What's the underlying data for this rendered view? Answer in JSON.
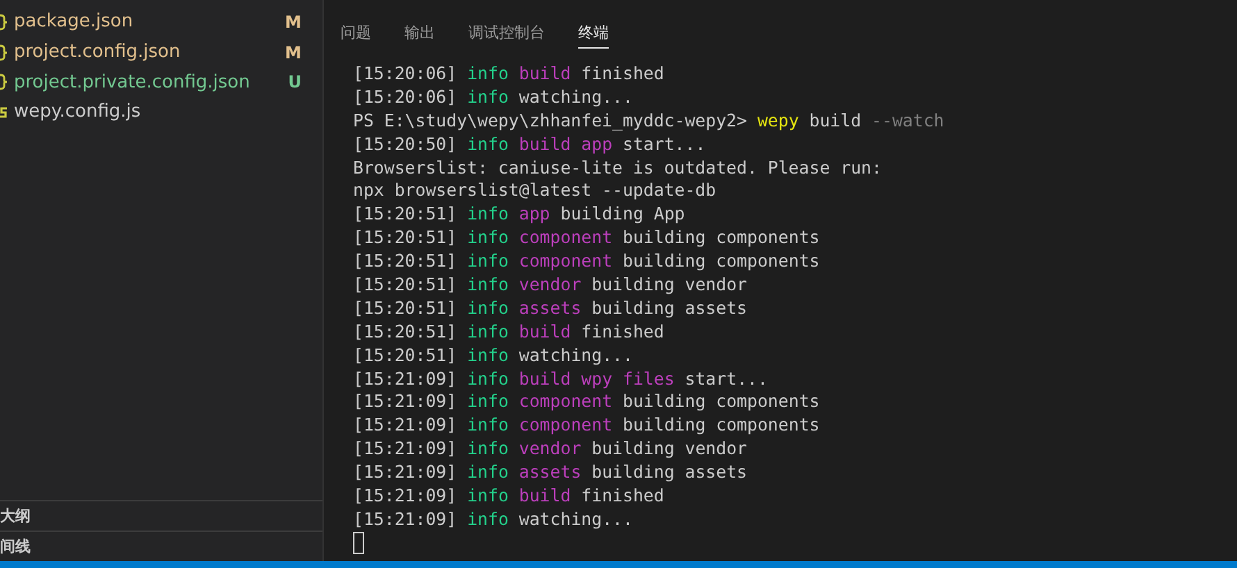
{
  "sidebar": {
    "files": [
      {
        "name": "package.json",
        "kind": "modified",
        "badge": "M"
      },
      {
        "name": "project.config.json",
        "kind": "modified",
        "badge": "M"
      },
      {
        "name": "project.private.config.json",
        "kind": "untracked",
        "badge": "U"
      },
      {
        "name": "wepy.config.js",
        "kind": "normal"
      }
    ],
    "sections": [
      {
        "label": "大纲"
      },
      {
        "label": "间线"
      }
    ]
  },
  "panel": {
    "tabs": [
      {
        "label": "问题",
        "selected": false
      },
      {
        "label": "输出",
        "selected": false
      },
      {
        "label": "调试控制台",
        "selected": false
      },
      {
        "label": "终端",
        "selected": true
      }
    ],
    "terminal": {
      "lines": [
        [
          {
            "text": "[15:20:06]",
            "kind": "plain"
          },
          {
            "text": "info",
            "kind": "info"
          },
          {
            "text": "build",
            "kind": "tag"
          },
          {
            "text": "finished",
            "kind": "plain"
          }
        ],
        [
          {
            "text": "[15:20:06]",
            "kind": "plain"
          },
          {
            "text": "info",
            "kind": "info"
          },
          {
            "text": "watching...",
            "kind": "plain"
          }
        ],
        [
          {
            "text": "PS E:\\study\\wepy\\zhhanfei_myddc-wepy2>",
            "kind": "plain"
          },
          {
            "text": "wepy",
            "kind": "cmd"
          },
          {
            "text": "build",
            "kind": "plain"
          },
          {
            "text": "--watch",
            "kind": "flag"
          }
        ],
        [
          {
            "text": "[15:20:50]",
            "kind": "plain"
          },
          {
            "text": "info",
            "kind": "info"
          },
          {
            "text": "build app",
            "kind": "tag"
          },
          {
            "text": "start...",
            "kind": "plain"
          }
        ],
        [
          {
            "text": "Browserslist: caniuse-lite is outdated. Please run:",
            "kind": "plain"
          }
        ],
        [
          {
            "text": "npx browserslist@latest --update-db",
            "kind": "plain"
          }
        ],
        [
          {
            "text": "[15:20:51]",
            "kind": "plain"
          },
          {
            "text": "info",
            "kind": "info"
          },
          {
            "text": "app",
            "kind": "tag"
          },
          {
            "text": "building App",
            "kind": "plain"
          }
        ],
        [
          {
            "text": "[15:20:51]",
            "kind": "plain"
          },
          {
            "text": "info",
            "kind": "info"
          },
          {
            "text": "component",
            "kind": "tag"
          },
          {
            "text": "building components",
            "kind": "plain"
          }
        ],
        [
          {
            "text": "[15:20:51]",
            "kind": "plain"
          },
          {
            "text": "info",
            "kind": "info"
          },
          {
            "text": "component",
            "kind": "tag"
          },
          {
            "text": "building components",
            "kind": "plain"
          }
        ],
        [
          {
            "text": "[15:20:51]",
            "kind": "plain"
          },
          {
            "text": "info",
            "kind": "info"
          },
          {
            "text": "vendor",
            "kind": "tag"
          },
          {
            "text": "building vendor",
            "kind": "plain"
          }
        ],
        [
          {
            "text": "[15:20:51]",
            "kind": "plain"
          },
          {
            "text": "info",
            "kind": "info"
          },
          {
            "text": "assets",
            "kind": "tag"
          },
          {
            "text": "building assets",
            "kind": "plain"
          }
        ],
        [
          {
            "text": "[15:20:51]",
            "kind": "plain"
          },
          {
            "text": "info",
            "kind": "info"
          },
          {
            "text": "build",
            "kind": "tag"
          },
          {
            "text": "finished",
            "kind": "plain"
          }
        ],
        [
          {
            "text": "[15:20:51]",
            "kind": "plain"
          },
          {
            "text": "info",
            "kind": "info"
          },
          {
            "text": "watching...",
            "kind": "plain"
          }
        ],
        [
          {
            "text": "[15:21:09]",
            "kind": "plain"
          },
          {
            "text": "info",
            "kind": "info"
          },
          {
            "text": "build wpy files",
            "kind": "tag"
          },
          {
            "text": "start...",
            "kind": "plain"
          }
        ],
        [
          {
            "text": "[15:21:09]",
            "kind": "plain"
          },
          {
            "text": "info",
            "kind": "info"
          },
          {
            "text": "component",
            "kind": "tag"
          },
          {
            "text": "building components",
            "kind": "plain"
          }
        ],
        [
          {
            "text": "[15:21:09]",
            "kind": "plain"
          },
          {
            "text": "info",
            "kind": "info"
          },
          {
            "text": "component",
            "kind": "tag"
          },
          {
            "text": "building components",
            "kind": "plain"
          }
        ],
        [
          {
            "text": "[15:21:09]",
            "kind": "plain"
          },
          {
            "text": "info",
            "kind": "info"
          },
          {
            "text": "vendor",
            "kind": "tag"
          },
          {
            "text": "building vendor",
            "kind": "plain"
          }
        ],
        [
          {
            "text": "[15:21:09]",
            "kind": "plain"
          },
          {
            "text": "info",
            "kind": "info"
          },
          {
            "text": "assets",
            "kind": "tag"
          },
          {
            "text": "building assets",
            "kind": "plain"
          }
        ],
        [
          {
            "text": "[15:21:09]",
            "kind": "plain"
          },
          {
            "text": "info",
            "kind": "info"
          },
          {
            "text": "build",
            "kind": "tag"
          },
          {
            "text": "finished",
            "kind": "plain"
          }
        ],
        [
          {
            "text": "[15:21:09]",
            "kind": "plain"
          },
          {
            "text": "info",
            "kind": "info"
          },
          {
            "text": "watching...",
            "kind": "plain"
          }
        ]
      ]
    }
  }
}
